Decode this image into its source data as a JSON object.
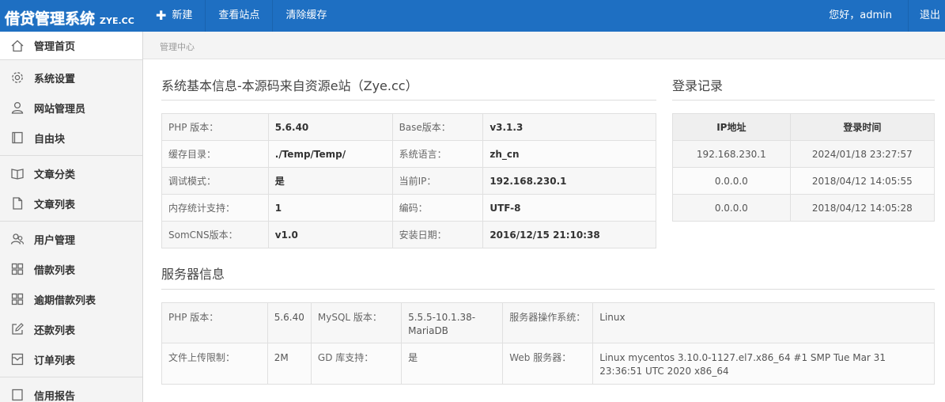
{
  "header": {
    "logo_main": "借贷管理系统",
    "logo_sub": "ZYE.CC",
    "nav": [
      {
        "label": "新建",
        "icon": "plus-icon"
      },
      {
        "label": "查看站点"
      },
      {
        "label": "清除缓存"
      }
    ],
    "greeting": "您好，admin",
    "logout": "退出"
  },
  "sidebar": {
    "items": [
      {
        "label": "管理首页",
        "icon": "home-icon"
      },
      {
        "label": "系统设置",
        "icon": "gear-icon"
      },
      {
        "label": "网站管理员",
        "icon": "user-icon"
      },
      {
        "label": "自由块",
        "icon": "book-icon"
      },
      {
        "label": "文章分类",
        "icon": "open-book-icon"
      },
      {
        "label": "文章列表",
        "icon": "file-icon"
      },
      {
        "label": "用户管理",
        "icon": "users-icon"
      },
      {
        "label": "借款列表",
        "icon": "grid-icon"
      },
      {
        "label": "逾期借款列表",
        "icon": "grid-icon"
      },
      {
        "label": "还款列表",
        "icon": "edit-icon"
      },
      {
        "label": "订单列表",
        "icon": "inbox-icon"
      },
      {
        "label": "信用报告",
        "icon": "report-icon"
      }
    ]
  },
  "breadcrumb": "管理中心",
  "system_info": {
    "title": "系统基本信息-本源码来自资源e站（Zye.cc）",
    "rows": [
      [
        "PHP 版本：",
        "5.6.40",
        "Base版本：",
        "v3.1.3"
      ],
      [
        "缓存目录：",
        "./Temp/Temp/",
        "系统语言：",
        "zh_cn"
      ],
      [
        "调试模式：",
        "是",
        "当前IP：",
        "192.168.230.1"
      ],
      [
        "内存统计支持：",
        "1",
        "编码：",
        "UTF-8"
      ],
      [
        "SomCNS版本：",
        "v1.0",
        "安装日期：",
        "2016/12/15 21:10:38"
      ]
    ]
  },
  "login_records": {
    "title": "登录记录",
    "headers": [
      "IP地址",
      "登录时间"
    ],
    "rows": [
      [
        "192.168.230.1",
        "2024/01/18 23:27:57"
      ],
      [
        "0.0.0.0",
        "2018/04/12 14:05:55"
      ],
      [
        "0.0.0.0",
        "2018/04/12 14:05:28"
      ]
    ]
  },
  "server_info": {
    "title": "服务器信息",
    "rows": [
      [
        "PHP 版本：",
        "5.6.40",
        "MySQL 版本：",
        "5.5.5-10.1.38-MariaDB",
        "服务器操作系统：",
        "Linux"
      ],
      [
        "文件上传限制：",
        "2M",
        "GD 库支持：",
        "是",
        "Web 服务器：",
        "Linux mycentos 3.10.0-1127.el7.x86_64 #1 SMP Tue Mar 31 23:36:51 UTC 2020 x86_64"
      ]
    ]
  }
}
